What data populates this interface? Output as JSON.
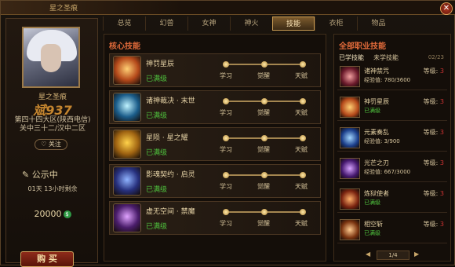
{
  "window": {
    "title": "星之圣痕",
    "close": "✕"
  },
  "profile": {
    "name": "星之圣痕",
    "level": "斌937",
    "server_line1": "第四十四大区(陕西电信)",
    "server_line2": "关中三十二/汉中二区",
    "follow_label": "关注",
    "status": "公示中",
    "remaining": "01天 13小时剩余",
    "price": "20000",
    "buy_label": "购 买"
  },
  "tabs": [
    {
      "label": "总览"
    },
    {
      "label": "幻兽"
    },
    {
      "label": "女神"
    },
    {
      "label": "神火"
    },
    {
      "label": "技能"
    },
    {
      "label": "衣柜"
    },
    {
      "label": "物品"
    }
  ],
  "core": {
    "title": "核心技能",
    "skills": [
      {
        "name": "神罚星辰",
        "status": "已满级",
        "colors": [
          "#ffcf74",
          "#b54a1b"
        ]
      },
      {
        "name": "诸神裁决 · 末世",
        "status": "已满级",
        "colors": [
          "#bff3ff",
          "#1b5d8a"
        ]
      },
      {
        "name": "星陨 · 星之耀",
        "status": "已满级",
        "colors": [
          "#ffd24a",
          "#a06412"
        ]
      },
      {
        "name": "影魂契约 · 启灵",
        "status": "已满级",
        "colors": [
          "#8fb3ff",
          "#27307d"
        ]
      },
      {
        "name": "虚无空间 · 禁魔",
        "status": "已满级",
        "colors": [
          "#e0a3ff",
          "#4a1d6b"
        ]
      }
    ],
    "track_labels": [
      "学习",
      "觉醒",
      "天赋"
    ]
  },
  "all": {
    "title": "全部职业技能",
    "tab_learned": "已学技能",
    "tab_unlearned": "未学技能",
    "page_count": "02/23",
    "level_label": "等级:",
    "level_value": "3",
    "items": [
      {
        "name": "诸神禁咒",
        "exp": "经验值: 780/3600",
        "exp_green": false,
        "colors": [
          "#f2a0a0",
          "#6b1a2b"
        ]
      },
      {
        "name": "神罚星辰",
        "exp": "已满级",
        "exp_green": true,
        "colors": [
          "#ffcf74",
          "#b54a1b"
        ]
      },
      {
        "name": "元素奏乱",
        "exp": "经验值: 3/900",
        "exp_green": false,
        "colors": [
          "#a3d7ff",
          "#1b3e8a"
        ]
      },
      {
        "name": "光芒之刃",
        "exp": "经验值: 667/3000",
        "exp_green": false,
        "colors": [
          "#d7a3ff",
          "#45186e"
        ]
      },
      {
        "name": "炼狱使者",
        "exp": "已满级",
        "exp_green": true,
        "colors": [
          "#ffb06a",
          "#7a2410"
        ]
      },
      {
        "name": "相空斩",
        "exp": "已满级",
        "exp_green": true,
        "colors": [
          "#ffcb8f",
          "#7a3410"
        ]
      }
    ]
  },
  "pager": {
    "prev": "◀",
    "next": "▶",
    "text": "1/4"
  }
}
